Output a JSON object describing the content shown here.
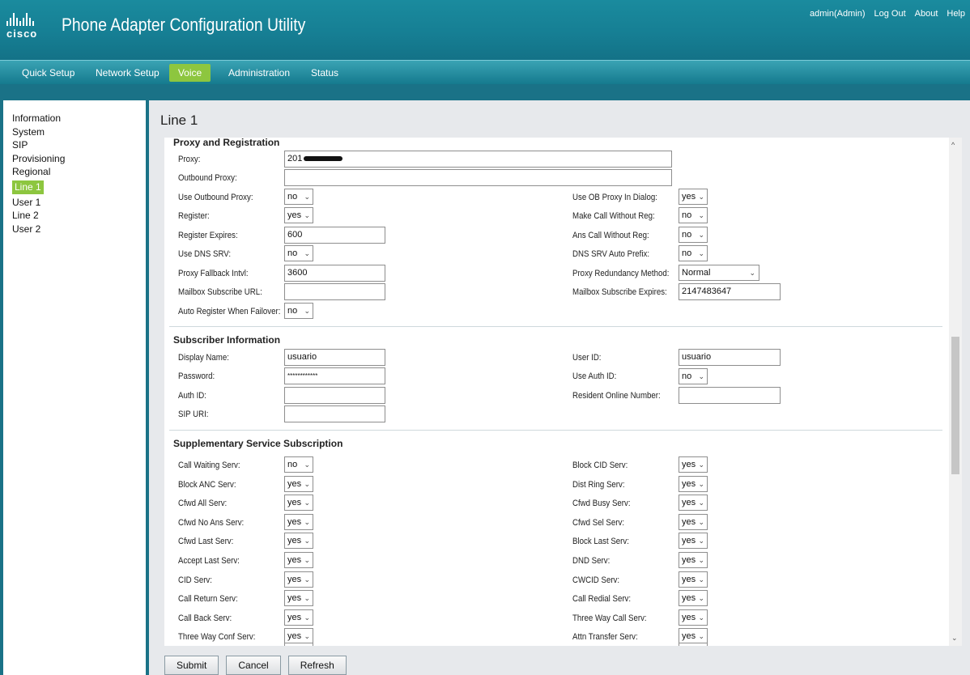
{
  "app": {
    "brand": "cisco",
    "title": "Phone Adapter Configuration Utility"
  },
  "top_links": [
    "admin(Admin)",
    "Log Out",
    "About",
    "Help"
  ],
  "nav": {
    "tabs": [
      "Quick Setup",
      "Network Setup",
      "Voice",
      "Administration",
      "Status"
    ],
    "active": "Voice"
  },
  "sidebar": {
    "items": [
      "Information",
      "System",
      "SIP",
      "Provisioning",
      "Regional",
      "Line 1",
      "User 1",
      "Line 2",
      "User 2"
    ],
    "active": "Line 1"
  },
  "page": {
    "heading": "Line 1"
  },
  "proxy_registration": {
    "title": "Proxy and Registration",
    "proxy": {
      "label": "Proxy:",
      "value": "201"
    },
    "outbound_proxy": {
      "label": "Outbound Proxy:",
      "value": ""
    },
    "use_outbound_proxy": {
      "label": "Use Outbound Proxy:",
      "value": "no"
    },
    "register": {
      "label": "Register:",
      "value": "yes"
    },
    "register_expires": {
      "label": "Register Expires:",
      "value": "600"
    },
    "use_dns_srv": {
      "label": "Use DNS SRV:",
      "value": "no"
    },
    "proxy_fallback_intvl": {
      "label": "Proxy Fallback Intvl:",
      "value": "3600"
    },
    "mailbox_subscribe_url": {
      "label": "Mailbox Subscribe URL:",
      "value": ""
    },
    "auto_register_when_failover": {
      "label": "Auto Register When Failover:",
      "value": "no"
    },
    "use_ob_proxy_in_dialog": {
      "label": "Use OB Proxy In Dialog:",
      "value": "yes"
    },
    "make_call_without_reg": {
      "label": "Make Call Without Reg:",
      "value": "no"
    },
    "ans_call_without_reg": {
      "label": "Ans Call Without Reg:",
      "value": "no"
    },
    "dns_srv_auto_prefix": {
      "label": "DNS SRV Auto Prefix:",
      "value": "no"
    },
    "proxy_redundancy_method": {
      "label": "Proxy Redundancy Method:",
      "value": "Normal"
    },
    "mailbox_subscribe_expires": {
      "label": "Mailbox Subscribe Expires:",
      "value": "2147483647"
    }
  },
  "subscriber": {
    "title": "Subscriber Information",
    "display_name": {
      "label": "Display Name:",
      "value": "usuario"
    },
    "password": {
      "label": "Password:",
      "value": "************"
    },
    "auth_id": {
      "label": "Auth ID:",
      "value": ""
    },
    "sip_uri": {
      "label": "SIP URI:",
      "value": ""
    },
    "user_id": {
      "label": "User ID:",
      "value": "usuario"
    },
    "use_auth_id": {
      "label": "Use Auth ID:",
      "value": "no"
    },
    "resident_online_number": {
      "label": "Resident Online Number:",
      "value": ""
    }
  },
  "supplementary": {
    "title": "Supplementary Service Subscription",
    "left": [
      {
        "label": "Call Waiting Serv:",
        "value": "no"
      },
      {
        "label": "Block ANC Serv:",
        "value": "yes"
      },
      {
        "label": "Cfwd All Serv:",
        "value": "yes"
      },
      {
        "label": "Cfwd No Ans Serv:",
        "value": "yes"
      },
      {
        "label": "Cfwd Last Serv:",
        "value": "yes"
      },
      {
        "label": "Accept Last Serv:",
        "value": "yes"
      },
      {
        "label": "CID Serv:",
        "value": "yes"
      },
      {
        "label": "Call Return Serv:",
        "value": "yes"
      },
      {
        "label": "Call Back Serv:",
        "value": "yes"
      },
      {
        "label": "Three Way Conf Serv:",
        "value": "yes"
      }
    ],
    "right": [
      {
        "label": "Block CID Serv:",
        "value": "yes"
      },
      {
        "label": "Dist Ring Serv:",
        "value": "yes"
      },
      {
        "label": "Cfwd Busy Serv:",
        "value": "yes"
      },
      {
        "label": "Cfwd Sel Serv:",
        "value": "yes"
      },
      {
        "label": "Block Last Serv:",
        "value": "yes"
      },
      {
        "label": "DND Serv:",
        "value": "yes"
      },
      {
        "label": "CWCID Serv:",
        "value": "yes"
      },
      {
        "label": "Call Redial Serv:",
        "value": "yes"
      },
      {
        "label": "Three Way Call Serv:",
        "value": "yes"
      },
      {
        "label": "Attn Transfer Serv:",
        "value": "yes"
      }
    ]
  },
  "buttons": {
    "submit": "Submit",
    "cancel": "Cancel",
    "refresh": "Refresh"
  }
}
